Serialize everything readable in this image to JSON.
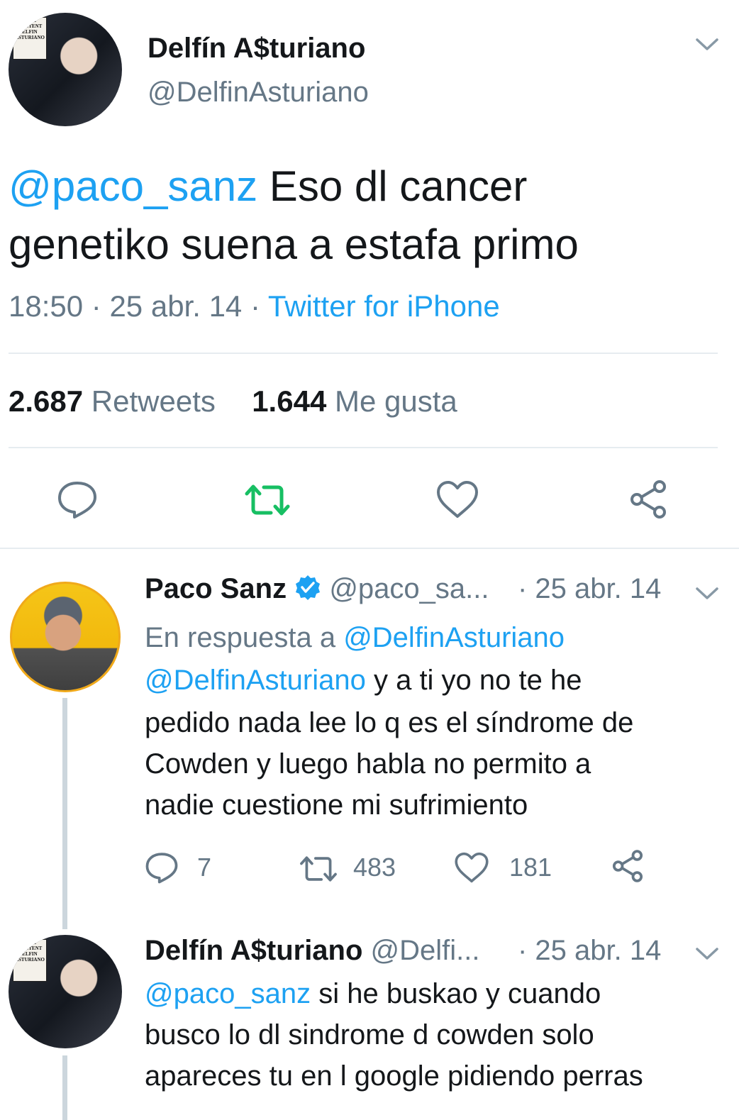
{
  "main_tweet": {
    "display_name": "Delfín A$turiano",
    "handle": "@DelfinAsturiano",
    "mention": "@paco_sanz",
    "text": " Eso dl cancer",
    "text_line2": "genetiko suena a estafa primo",
    "time": "18:50",
    "date": "25 abr. 14",
    "source": "Twitter for iPhone",
    "sep": "·",
    "retweets_count": "2.687",
    "retweets_label": "Retweets",
    "likes_count": "1.644",
    "likes_label": "Me gusta"
  },
  "reply1": {
    "display_name": "Paco Sanz",
    "handle": "@paco_sa...",
    "date": "· 25 abr. 14",
    "reply_to_prefix": "En respuesta a ",
    "reply_to_handle": "@DelfinAsturiano",
    "mention": "@DelfinAsturiano",
    "line1": " y a ti yo no te he",
    "line2": "pedido nada lee lo q es el síndrome de",
    "line3": "Cowden y luego habla no permito a",
    "line4": "nadie cuestione mi sufrimiento",
    "reply_count": "7",
    "retweet_count": "483",
    "like_count": "181"
  },
  "reply2": {
    "display_name": "Delfín A$turiano",
    "handle": "@Delfi...",
    "date": "· 25 abr. 14",
    "mention": "@paco_sanz",
    "line1": " si he buskao y cuando",
    "line2": "busco lo dl sindrome d cowden solo",
    "line3": "apareces tu en l google pidiendo perras"
  },
  "avatar_badge_text": "CORY CONTENT ELFIN ASTURIANO",
  "colors": {
    "link": "#1da1f2",
    "retweet_active": "#17bf63",
    "muted": "#657786",
    "icon": "#657786",
    "divider": "#e6ecf0",
    "verified": "#1da1f2"
  },
  "icons": [
    "chevron-down-icon",
    "reply-icon",
    "retweet-icon",
    "like-icon",
    "share-icon",
    "verified-icon"
  ]
}
